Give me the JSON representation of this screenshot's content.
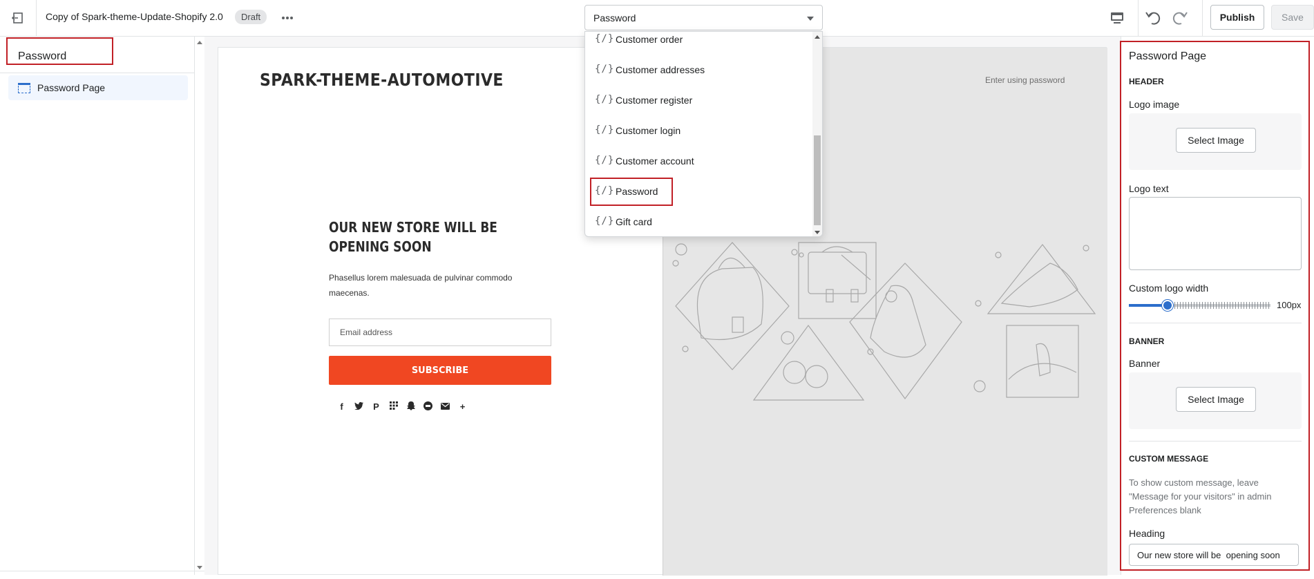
{
  "topbar": {
    "theme_name": "Copy of Spark-theme-Update-Shopify 2.0",
    "status_badge": "Draft",
    "template_selected": "Password",
    "publish_label": "Publish",
    "save_label": "Save"
  },
  "left_sidebar": {
    "title": "Password",
    "section_label": "Password Page"
  },
  "template_dropdown": {
    "items": [
      {
        "icon": "{/}",
        "label": "Customer order"
      },
      {
        "icon": "{/}",
        "label": "Customer addresses"
      },
      {
        "icon": "{/}",
        "label": "Customer register"
      },
      {
        "icon": "{/}",
        "label": "Customer login"
      },
      {
        "icon": "{/}",
        "label": "Customer account"
      },
      {
        "icon": "{/}",
        "label": "Password"
      },
      {
        "icon": "{/}",
        "label": "Gift card"
      }
    ]
  },
  "preview": {
    "logo_text": "SPARK-THEME-AUTOMOTIVE",
    "enter_link": "Enter using password",
    "heading": "OUR NEW STORE WILL BE OPENING SOON",
    "subtext": "Phasellus lorem malesuada de pulvinar commodo maecenas.",
    "email_placeholder": "Email address",
    "subscribe_label": "SUBSCRIBE",
    "social_icons": [
      "facebook-icon",
      "twitter-icon",
      "pinterest-icon",
      "houzz-icon",
      "snapchat-icon",
      "tumblr-icon",
      "email-icon",
      "plus-icon"
    ]
  },
  "right_panel": {
    "title": "Password Page",
    "header_heading": "HEADER",
    "logo_image_label": "Logo image",
    "select_image_label": "Select Image",
    "logo_text_label": "Logo text",
    "logo_width_label": "Custom logo width",
    "logo_width_value": "100px",
    "banner_heading": "BANNER",
    "banner_label": "Banner",
    "banner_select_label": "Select Image",
    "custom_message_heading": "CUSTOM MESSAGE",
    "custom_message_help": "To show custom message, leave \"Message for your visitors\" in admin Preferences blank",
    "heading_label": "Heading",
    "heading_value": "Our new store will be  opening soon"
  },
  "colors": {
    "accent": "#2c6ecb",
    "subscribe": "#f04722",
    "highlight": "#c12026"
  }
}
